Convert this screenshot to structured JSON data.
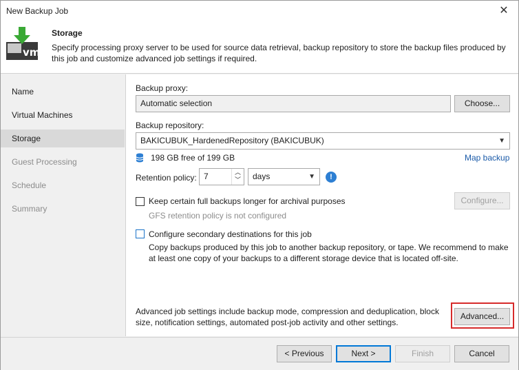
{
  "window": {
    "title": "New Backup Job",
    "close_glyph": "✕"
  },
  "header": {
    "title": "Storage",
    "description": "Specify processing proxy server to be used for source data retrieval, backup repository to store the backup files produced by this job and customize advanced job settings if required.",
    "icon": "vm-backup-icon",
    "icon_text": "vm"
  },
  "sidebar": {
    "items": [
      {
        "label": "Name",
        "state": "normal"
      },
      {
        "label": "Virtual Machines",
        "state": "normal"
      },
      {
        "label": "Storage",
        "state": "active"
      },
      {
        "label": "Guest Processing",
        "state": "disabled"
      },
      {
        "label": "Schedule",
        "state": "disabled"
      },
      {
        "label": "Summary",
        "state": "disabled"
      }
    ]
  },
  "storage": {
    "proxy_label": "Backup proxy:",
    "proxy_value": "Automatic selection",
    "choose_button": "Choose...",
    "repository_label": "Backup repository:",
    "repository_value": "BAKICUBUK_HardenedRepository (BAKICUBUK)",
    "free_space": "198 GB free of 199 GB",
    "map_backup_link": "Map backup",
    "retention_label": "Retention policy:",
    "retention_value": "7",
    "retention_unit": "days",
    "keep_full_label": "Keep certain full backups longer for archival purposes",
    "gfs_status": "GFS retention policy is not configured",
    "configure_button": "Configure...",
    "secondary_label": "Configure secondary destinations for this job",
    "secondary_desc": "Copy backups produced by this job to another backup repository, or tape. We recommend to make at least one copy of your backups to a different storage device that is located off-site.",
    "advanced_desc": "Advanced job settings include backup mode, compression and deduplication, block size, notification settings, automated post-job activity and other settings.",
    "advanced_button": "Advanced..."
  },
  "footer": {
    "previous": "< Previous",
    "next": "Next >",
    "finish": "Finish",
    "cancel": "Cancel"
  },
  "colors": {
    "accent": "#0078d7",
    "highlight": "#d62a2a",
    "link": "#1a5aa8"
  }
}
